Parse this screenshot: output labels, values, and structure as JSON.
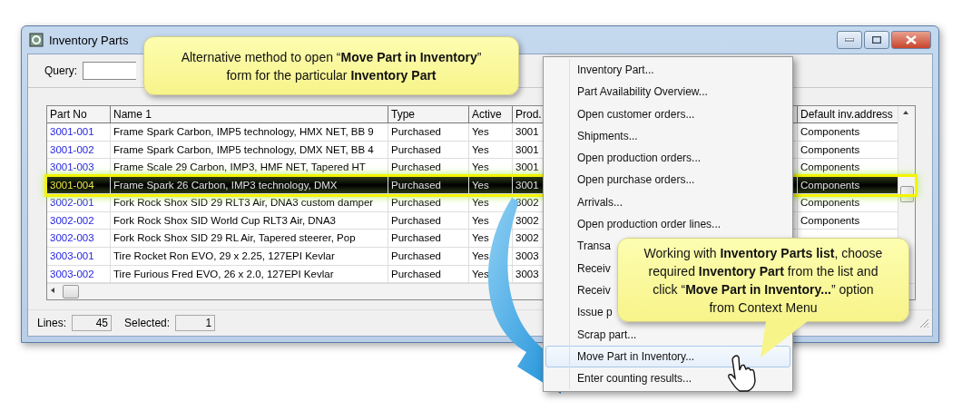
{
  "window": {
    "title": "Inventory Parts"
  },
  "query": {
    "label": "Query:"
  },
  "table": {
    "columns": [
      "Part No",
      "Name 1",
      "Type",
      "Active",
      "Prod.",
      "Default inv.address"
    ],
    "rows": [
      {
        "part_no": "3001-001",
        "name": "Frame Spark Carbon, IMP5 technology, HMX NET, BB 9",
        "type": "Purchased",
        "active": "Yes",
        "prod": "3001",
        "address": "Components",
        "selected": false
      },
      {
        "part_no": "3001-002",
        "name": "Frame Spark Carbon, IMP5 technology, DMX NET, BB 4",
        "type": "Purchased",
        "active": "Yes",
        "prod": "3001",
        "address": "Components",
        "selected": false
      },
      {
        "part_no": "3001-003",
        "name": "Frame Scale 29 Carbon, IMP3, HMF NET, Tapered HT",
        "type": "Purchased",
        "active": "Yes",
        "prod": "3001",
        "address": "Components",
        "selected": false
      },
      {
        "part_no": "3001-004",
        "name": "Frame Spark 26 Carbon, IMP3 technology, DMX",
        "type": "Purchased",
        "active": "Yes",
        "prod": "3001",
        "address": "Components",
        "selected": true
      },
      {
        "part_no": "3002-001",
        "name": "Fork Rock Shox SID 29 RLT3 Air, DNA3 custom damper",
        "type": "Purchased",
        "active": "Yes",
        "prod": "3002",
        "address": "Components",
        "selected": false
      },
      {
        "part_no": "3002-002",
        "name": "Fork Rock Shox SID World Cup RLT3 Air, DNA3",
        "type": "Purchased",
        "active": "Yes",
        "prod": "3002",
        "address": "Components",
        "selected": false
      },
      {
        "part_no": "3002-003",
        "name": "Fork Rock Shox SID 29 RL Air, Tapered steerer, Pop",
        "type": "Purchased",
        "active": "Yes",
        "prod": "3002",
        "selected": false
      },
      {
        "part_no": "3003-001",
        "name": "Tire Rocket Ron EVO, 29 x 2.25, 127EPI Kevlar",
        "type": "Purchased",
        "active": "Yes",
        "prod": "3003",
        "selected": false
      },
      {
        "part_no": "3003-002",
        "name": "Tire Furious Fred EVO, 26 x 2.0, 127EPI Kevlar",
        "type": "Purchased",
        "active": "Yes",
        "prod": "3003",
        "selected": false
      }
    ]
  },
  "status_bar": {
    "lines_label": "Lines:",
    "lines": "45",
    "selected_label": "Selected:",
    "selected": "1"
  },
  "context_menu": {
    "items": [
      {
        "label": "Inventory Part...",
        "selected": false
      },
      {
        "label": "Part Availability Overview...",
        "selected": false
      },
      {
        "label": "Open customer orders...",
        "selected": false
      },
      {
        "label": "Shipments...",
        "selected": false
      },
      {
        "label": "Open production orders...",
        "selected": false
      },
      {
        "label": "Open purchase orders...",
        "selected": false
      },
      {
        "label": "Arrivals...",
        "selected": false
      },
      {
        "label": "Open production order lines...",
        "selected": false
      },
      {
        "label": "Transa",
        "selected": false
      },
      {
        "label": "Receiv",
        "selected": false
      },
      {
        "label": "Receiv",
        "selected": false
      },
      {
        "label": "Issue p",
        "selected": false
      },
      {
        "label": "Scrap part...",
        "selected": false
      },
      {
        "label": "Move Part in Inventory...",
        "selected": true
      },
      {
        "label": "Enter counting results...",
        "selected": false
      }
    ]
  },
  "callouts": [
    {
      "text": "Alternative method to open “**Move Part in Inventory**” form for the particular **Inventory Part**"
    },
    {
      "text": "Working with **Inventory Parts list**, choose required **Inventory Part** from the list and click “**Move Part in Inventory...**” option from Context Menu"
    }
  ]
}
